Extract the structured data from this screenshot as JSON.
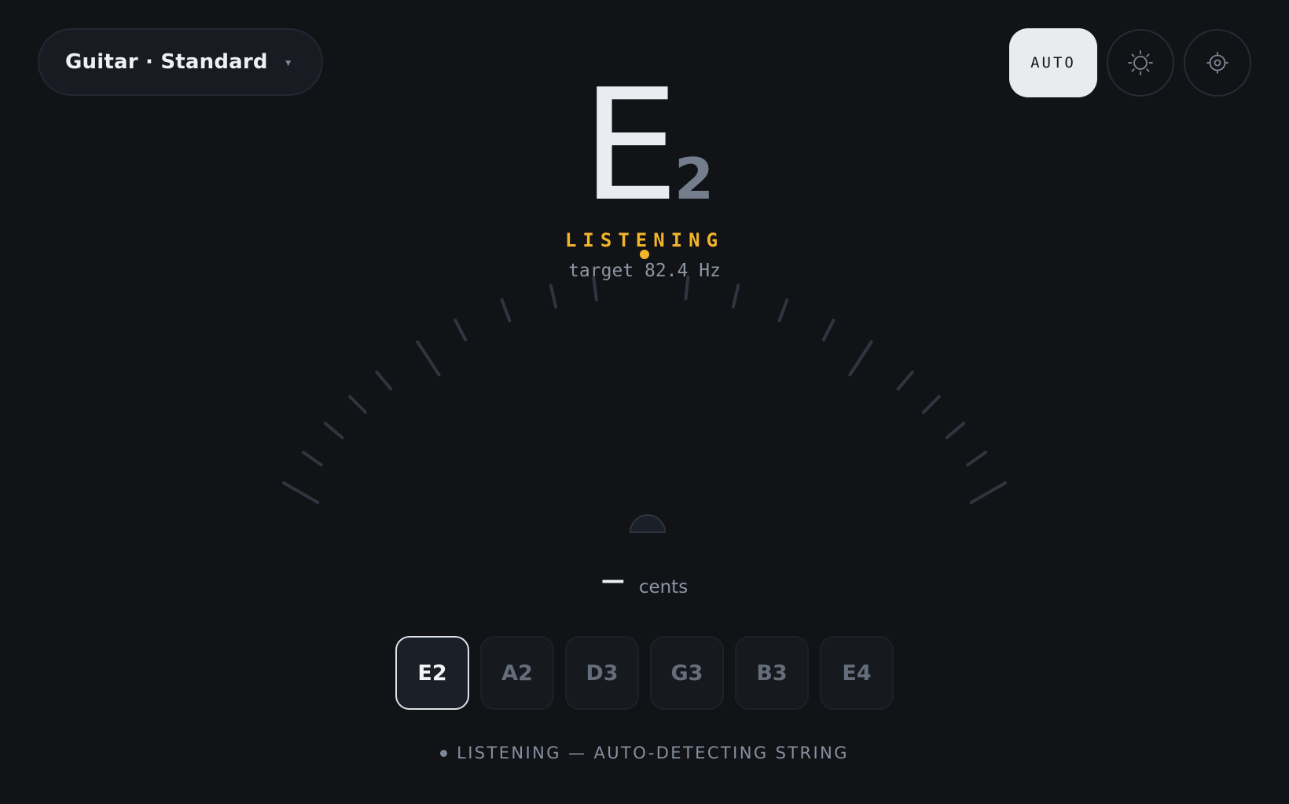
{
  "instrument": {
    "label": "Guitar · Standard",
    "caret_icon": "caret-down-icon"
  },
  "controls": {
    "auto_label": "AUTO",
    "theme_icon": "sun-icon",
    "settings_icon": "gear-icon"
  },
  "note": {
    "letter": "E",
    "octave": "2"
  },
  "status": {
    "label": "LISTENING",
    "target": "target 82.4 Hz"
  },
  "meter": {
    "needle_cents": 0,
    "range_cents": [
      -50,
      50
    ],
    "center_marker_color": "#f2b42b"
  },
  "cents": {
    "value": "—",
    "unit": "cents"
  },
  "strings": [
    {
      "label": "E2",
      "active": true
    },
    {
      "label": "A2",
      "active": false
    },
    {
      "label": "D3",
      "active": false
    },
    {
      "label": "G3",
      "active": false
    },
    {
      "label": "B3",
      "active": false
    },
    {
      "label": "E4",
      "active": false
    }
  ],
  "footer": {
    "status": "LISTENING — AUTO-DETECTING STRING"
  },
  "colors": {
    "background": "#111317",
    "accent": "#f2b42b",
    "text": "#e9edf1",
    "muted": "#8c95a2"
  }
}
